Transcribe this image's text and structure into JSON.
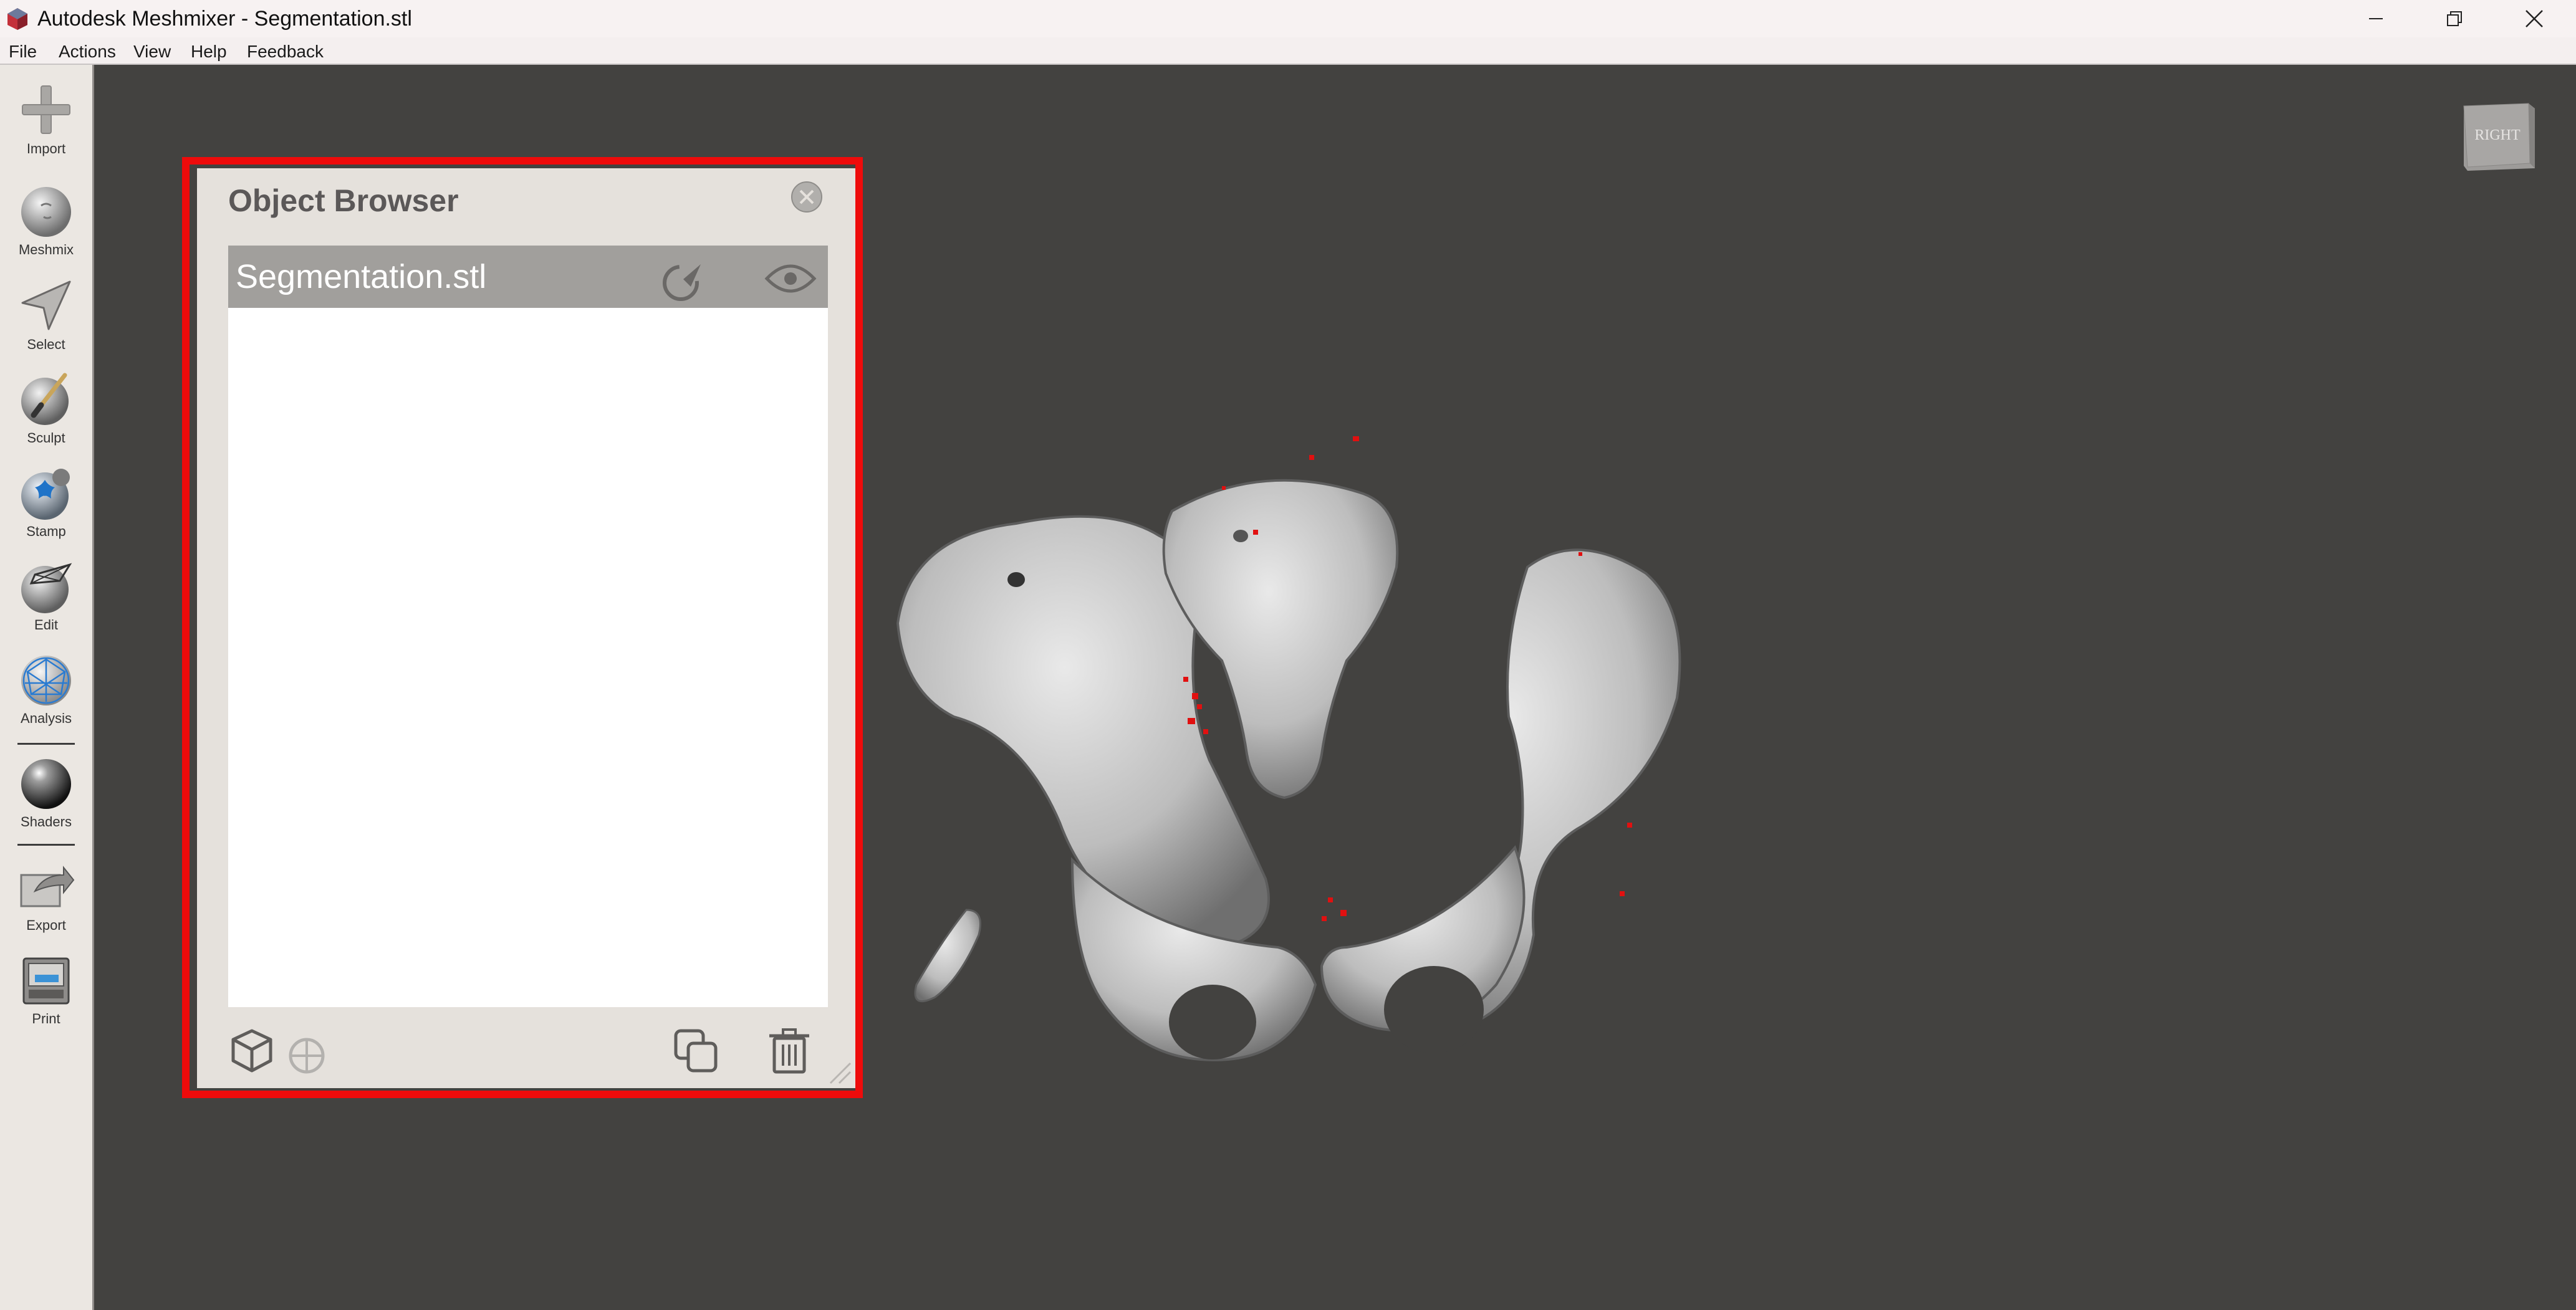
{
  "window": {
    "title": "Autodesk Meshmixer - Segmentation.stl",
    "controls": [
      "minimize",
      "restore",
      "close"
    ]
  },
  "menu": {
    "items": [
      "File",
      "Actions",
      "View",
      "Help",
      "Feedback"
    ]
  },
  "toolbar": {
    "tools": [
      {
        "label": "Import",
        "icon": "plus-icon"
      },
      {
        "label": "Meshmix",
        "icon": "meshmix-icon"
      },
      {
        "label": "Select",
        "icon": "arrow-cursor-icon"
      },
      {
        "label": "Sculpt",
        "icon": "brush-icon"
      },
      {
        "label": "Stamp",
        "icon": "stamp-icon"
      },
      {
        "label": "Edit",
        "icon": "edit-mesh-icon"
      },
      {
        "label": "Analysis",
        "icon": "analysis-icon"
      },
      {
        "label": "Shaders",
        "icon": "shader-sphere-icon"
      },
      {
        "label": "Export",
        "icon": "export-icon"
      },
      {
        "label": "Print",
        "icon": "printer-icon"
      }
    ]
  },
  "viewport": {
    "nav_cube_label": "RIGHT"
  },
  "object_browser": {
    "title": "Object Browser",
    "objects": [
      {
        "name": "Segmentation.stl",
        "selected": true,
        "visible": true
      }
    ],
    "footer_icons": [
      "cube-icon",
      "pivot-icon",
      "duplicate-icon",
      "trash-icon"
    ]
  },
  "colors": {
    "viewport_bg": "#434240",
    "highlight": "#ee0b0b",
    "panel_bg": "#e5e1dc",
    "selected_row": "#a19f9c"
  }
}
